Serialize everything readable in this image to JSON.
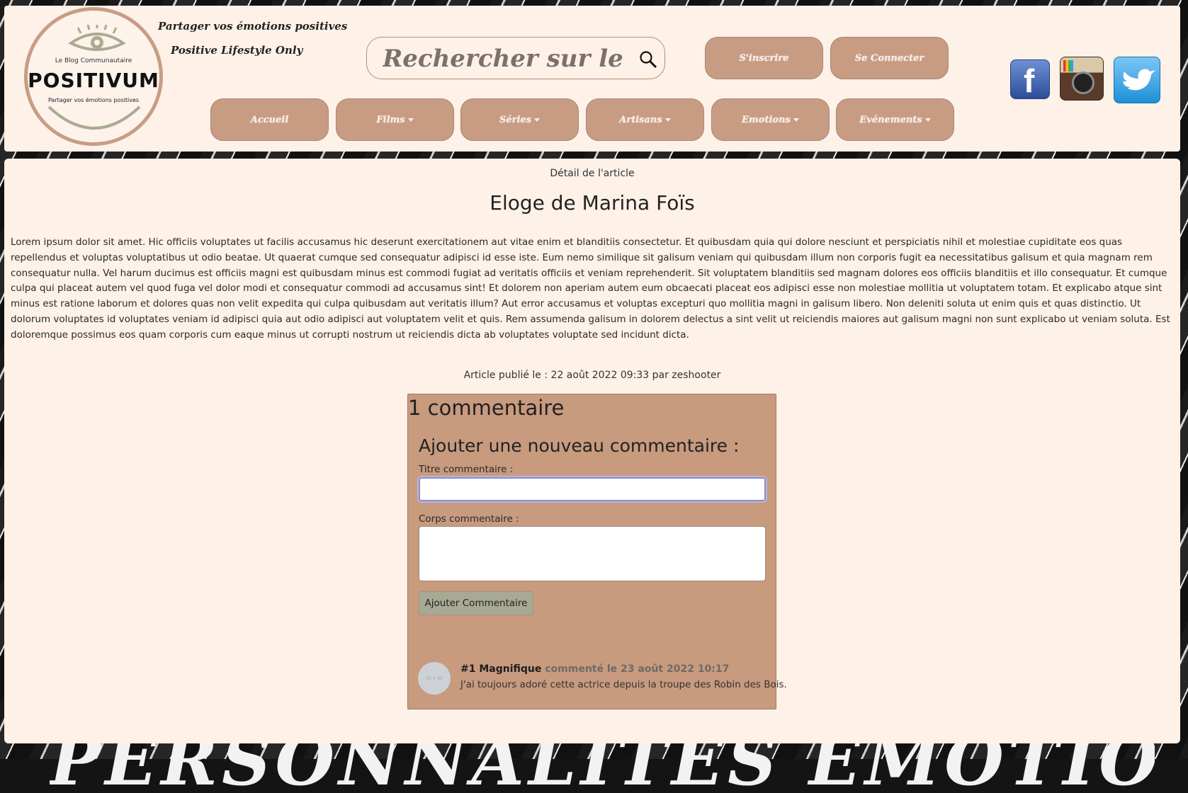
{
  "header": {
    "logo": {
      "blog_label": "Le Blog Communautaire",
      "brand": "POSITIVUM",
      "tagline": "Partager vos émotions positives"
    },
    "tagline_1": "Partager vos émotions positives",
    "tagline_2": "Positive Lifestyle Only",
    "search": {
      "placeholder": "Rechercher sur le site",
      "icon": "search-icon"
    },
    "auth": {
      "signup": "S'inscrire",
      "login": "Se Connecter"
    },
    "nav": [
      {
        "label": "Accueil",
        "dropdown": false
      },
      {
        "label": "Films",
        "dropdown": true
      },
      {
        "label": "Séries",
        "dropdown": true
      },
      {
        "label": "Artisans",
        "dropdown": true
      },
      {
        "label": "Emotions",
        "dropdown": true
      },
      {
        "label": "Evénements",
        "dropdown": true
      }
    ],
    "social": [
      "facebook-icon",
      "instagram-icon",
      "twitter-icon"
    ]
  },
  "article": {
    "breadcrumb": "Détail de l'article",
    "title": "Eloge de Marina Foïs",
    "body": "Lorem ipsum dolor sit amet. Hic officiis voluptates ut facilis accusamus hic deserunt exercitationem aut vitae enim et blanditiis consectetur. Et quibusdam quia qui dolore nesciunt et perspiciatis nihil et molestiae cupiditate eos quas repellendus et voluptas voluptatibus ut odio beatae. Ut quaerat cumque sed consequatur adipisci id esse iste. Eum nemo similique sit galisum veniam qui quibusdam illum non corporis fugit ea necessitatibus galisum et quia magnam rem consequatur nulla. Vel harum ducimus est officiis magni est quibusdam minus est commodi fugiat ad veritatis officiis et veniam reprehenderit. Sit voluptatem blanditiis sed magnam dolores eos officiis blanditiis et illo consequatur. Et cumque culpa qui placeat autem vel quod fuga vel dolor modi et consequatur commodi ad accusamus sint! Et dolorem non aperiam autem eum obcaecati placeat eos adipisci esse non molestiae mollitia ut voluptatem totam. Et explicabo atque sint minus est ratione laborum et dolores quas non velit expedita qui culpa quibusdam aut veritatis illum? Aut error accusamus et voluptas excepturi quo mollitia magni in galisum libero. Non deleniti soluta ut enim quis et quas distinctio. Ut dolorum voluptates id voluptates veniam id adipisci quia aut odio adipisci aut voluptatem velit et quis. Rem assumenda galisum in dolorem delectus a sint velit ut reiciendis maiores aut galisum magni non sunt explicabo ut veniam soluta. Est doloremque possimus eos quam corporis cum eaque minus ut corrupti nostrum ut reiciendis dicta ab voluptates voluptate sed incidunt dicta.",
    "meta": "Article publié le : 22 août 2022 09:33 par zeshooter"
  },
  "comments": {
    "count_label": "1 commentaire",
    "form_title": "Ajouter une nouveau commentaire :",
    "title_label": "Titre commentaire :",
    "title_value": "",
    "body_label": "Corps commentaire :",
    "body_value": "",
    "submit_label": "Ajouter Commentaire",
    "items": [
      {
        "avatar_text": "50 × 50",
        "head": "#1 Magnifique",
        "date": "commenté le 23 août 2022 10:17",
        "body": "J'ai toujours adoré cette actrice depuis la troupe des Robin des Bois."
      }
    ]
  },
  "background_text": "PERSONNALITÉS ÉMOTIONNELLES",
  "colors": {
    "header_bg": "#fdf1e8",
    "pill": "#c89c83",
    "comment_box": "#c89a7e",
    "submit_button": "#a8a994"
  }
}
